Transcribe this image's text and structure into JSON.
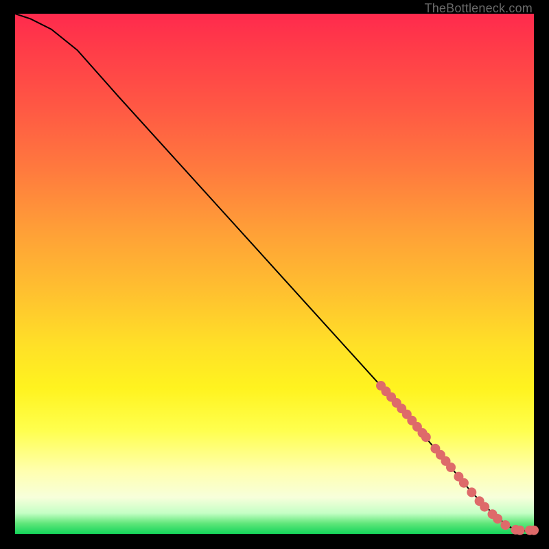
{
  "attribution": "TheBottleneck.com",
  "colors": {
    "marker": "#de6a6a",
    "curve": "#000000",
    "gradient_stops": [
      "#ff2a4d",
      "#ff3a49",
      "#ff5844",
      "#ff7a3e",
      "#ffa037",
      "#ffc22f",
      "#ffe127",
      "#fff31f",
      "#ffff4d",
      "#ffffb0",
      "#f7ffdb",
      "#c5ffc5",
      "#5fe67a",
      "#14d45a"
    ]
  },
  "chart_data": {
    "type": "line",
    "title": "",
    "xlabel": "",
    "ylabel": "",
    "xlim": [
      0,
      100
    ],
    "ylim": [
      0,
      100
    ],
    "curve": {
      "x": [
        0,
        3,
        7,
        12,
        20,
        30,
        40,
        50,
        60,
        70,
        77,
        83,
        88,
        92,
        95,
        97,
        100
      ],
      "y": [
        100,
        99,
        97,
        93,
        84,
        73,
        62,
        51,
        40,
        29,
        21,
        14,
        8,
        4,
        1.5,
        0.6,
        0.6
      ]
    },
    "markers": {
      "note": "salmon dot clusters along lower-right portion of the curve",
      "points": [
        {
          "x": 70.5,
          "y": 28.5
        },
        {
          "x": 71.5,
          "y": 27.4
        },
        {
          "x": 72.5,
          "y": 26.3
        },
        {
          "x": 73.5,
          "y": 25.2
        },
        {
          "x": 74.5,
          "y": 24.1
        },
        {
          "x": 75.5,
          "y": 23.0
        },
        {
          "x": 76.5,
          "y": 21.8
        },
        {
          "x": 77.5,
          "y": 20.6
        },
        {
          "x": 78.5,
          "y": 19.4
        },
        {
          "x": 79.2,
          "y": 18.6
        },
        {
          "x": 81.0,
          "y": 16.4
        },
        {
          "x": 82.0,
          "y": 15.2
        },
        {
          "x": 83.0,
          "y": 14.0
        },
        {
          "x": 84.0,
          "y": 12.8
        },
        {
          "x": 85.5,
          "y": 11.0
        },
        {
          "x": 86.5,
          "y": 9.8
        },
        {
          "x": 88.0,
          "y": 8.0
        },
        {
          "x": 89.5,
          "y": 6.3
        },
        {
          "x": 90.5,
          "y": 5.2
        },
        {
          "x": 92.0,
          "y": 3.8
        },
        {
          "x": 93.0,
          "y": 2.9
        },
        {
          "x": 94.5,
          "y": 1.7
        },
        {
          "x": 96.5,
          "y": 0.8
        },
        {
          "x": 97.3,
          "y": 0.7
        },
        {
          "x": 99.2,
          "y": 0.7
        },
        {
          "x": 100.0,
          "y": 0.7
        }
      ]
    }
  }
}
